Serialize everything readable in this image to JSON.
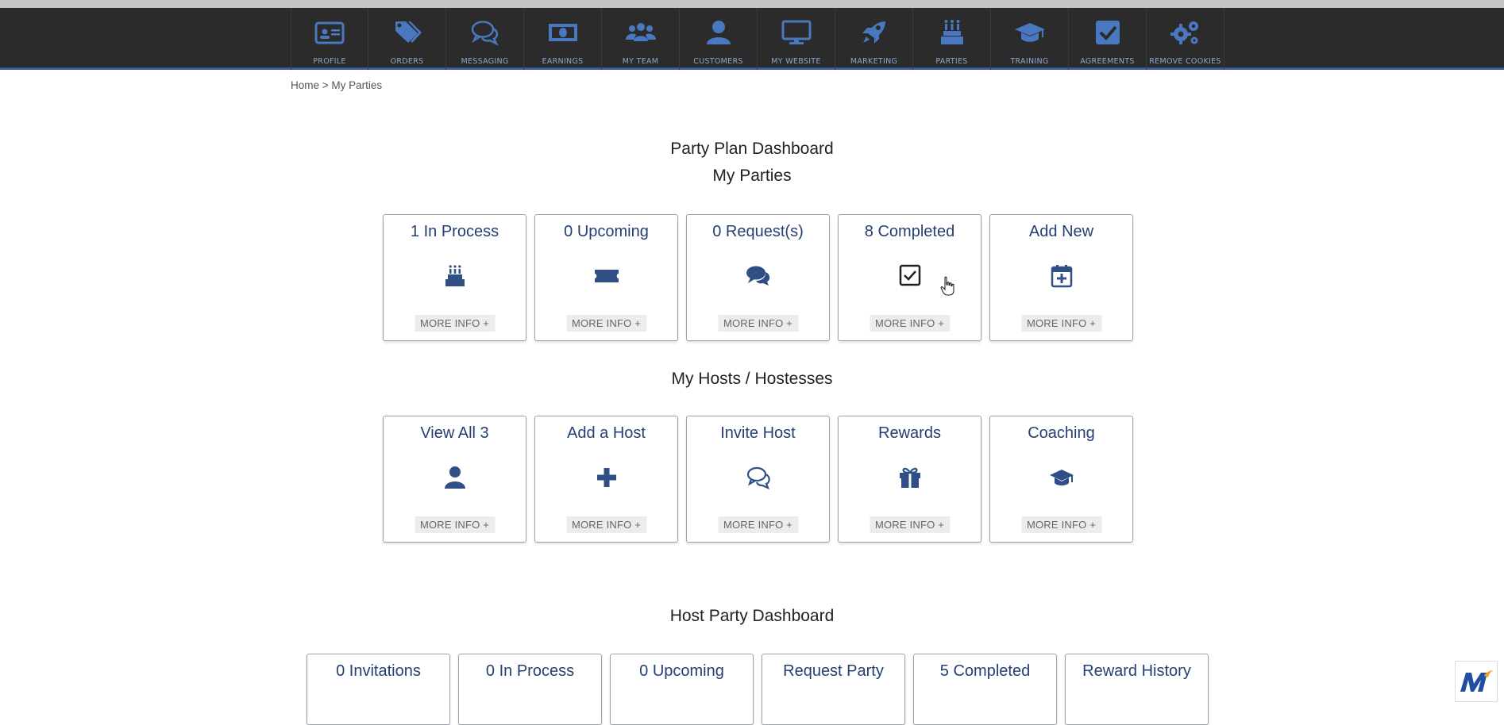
{
  "nav": {
    "items": [
      {
        "label": "PROFILE",
        "icon": "profile-card-icon"
      },
      {
        "label": "ORDERS",
        "icon": "tags-icon"
      },
      {
        "label": "MESSAGING",
        "icon": "chat-bubbles-icon"
      },
      {
        "label": "EARNINGS",
        "icon": "money-bill-icon"
      },
      {
        "label": "MY TEAM",
        "icon": "team-icon"
      },
      {
        "label": "CUSTOMERS",
        "icon": "user-icon"
      },
      {
        "label": "MY WEBSITE",
        "icon": "monitor-icon"
      },
      {
        "label": "MARKETING",
        "icon": "rocket-icon"
      },
      {
        "label": "PARTIES",
        "icon": "birthday-cake-icon"
      },
      {
        "label": "TRAINING",
        "icon": "graduation-cap-icon"
      },
      {
        "label": "AGREEMENTS",
        "icon": "check-square-icon"
      },
      {
        "label": "REMOVE COOKIES",
        "icon": "gears-icon"
      }
    ]
  },
  "breadcrumb": {
    "home": "Home",
    "sep": " > ",
    "current": "My Parties"
  },
  "dashboard": {
    "title": "Party Plan Dashboard",
    "subtitle": "My Parties"
  },
  "parties": [
    {
      "title": "1 In Process",
      "icon": "birthday-cake-icon",
      "more": "MORE INFO +"
    },
    {
      "title": "0 Upcoming",
      "icon": "ticket-icon",
      "more": "MORE INFO +"
    },
    {
      "title": "0 Request(s)",
      "icon": "comments-icon",
      "more": "MORE INFO +"
    },
    {
      "title": "8 Completed",
      "icon": "check-square-icon",
      "more": "MORE INFO +"
    },
    {
      "title": "Add New",
      "icon": "calendar-plus-icon",
      "more": "MORE INFO +"
    }
  ],
  "hosts_title": "My Hosts / Hostesses",
  "hosts": [
    {
      "title": "View All 3",
      "icon": "user-icon",
      "more": "MORE INFO +"
    },
    {
      "title": "Add a Host",
      "icon": "plus-icon",
      "more": "MORE INFO +"
    },
    {
      "title": "Invite Host",
      "icon": "chat-outline-icon",
      "more": "MORE INFO +"
    },
    {
      "title": "Rewards",
      "icon": "gift-icon",
      "more": "MORE INFO +"
    },
    {
      "title": "Coaching",
      "icon": "graduation-cap-icon",
      "more": "MORE INFO +"
    }
  ],
  "host_dashboard_title": "Host Party Dashboard",
  "host_party": [
    {
      "title": "0 Invitations"
    },
    {
      "title": "0 In Process"
    },
    {
      "title": "0 Upcoming"
    },
    {
      "title": "Request Party"
    },
    {
      "title": "5 Completed"
    },
    {
      "title": "Reward History"
    }
  ],
  "colors": {
    "navbar": "#2b2b2b",
    "nav_icon": "#4a78c0",
    "accent": "#243f73"
  }
}
